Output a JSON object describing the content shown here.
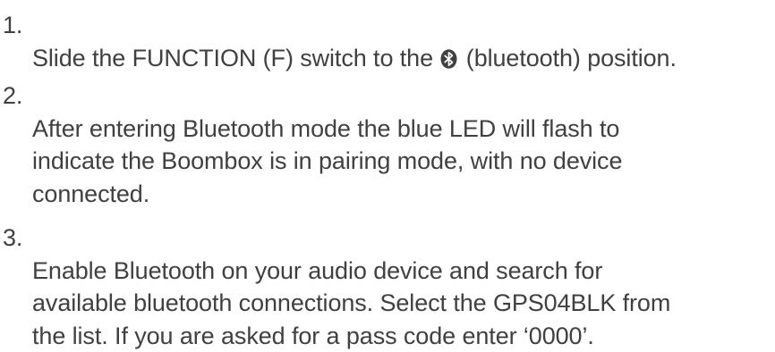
{
  "steps": [
    {
      "number": "1.",
      "text_before_icon": "Slide the FUNCTION (F) switch to the ",
      "icon": "bluetooth-icon",
      "text_after_icon": " (bluetooth) position."
    },
    {
      "number": "2.",
      "text": "After entering Bluetooth mode the blue LED will flash to\nindicate the Boombox is in pairing mode, with no device\nconnected."
    },
    {
      "number": "3.",
      "text": "Enable Bluetooth on your audio device and search for\navailable bluetooth connections. Select the GPS04BLK from\nthe list. If you are asked for a pass code enter ‘0000’."
    }
  ]
}
